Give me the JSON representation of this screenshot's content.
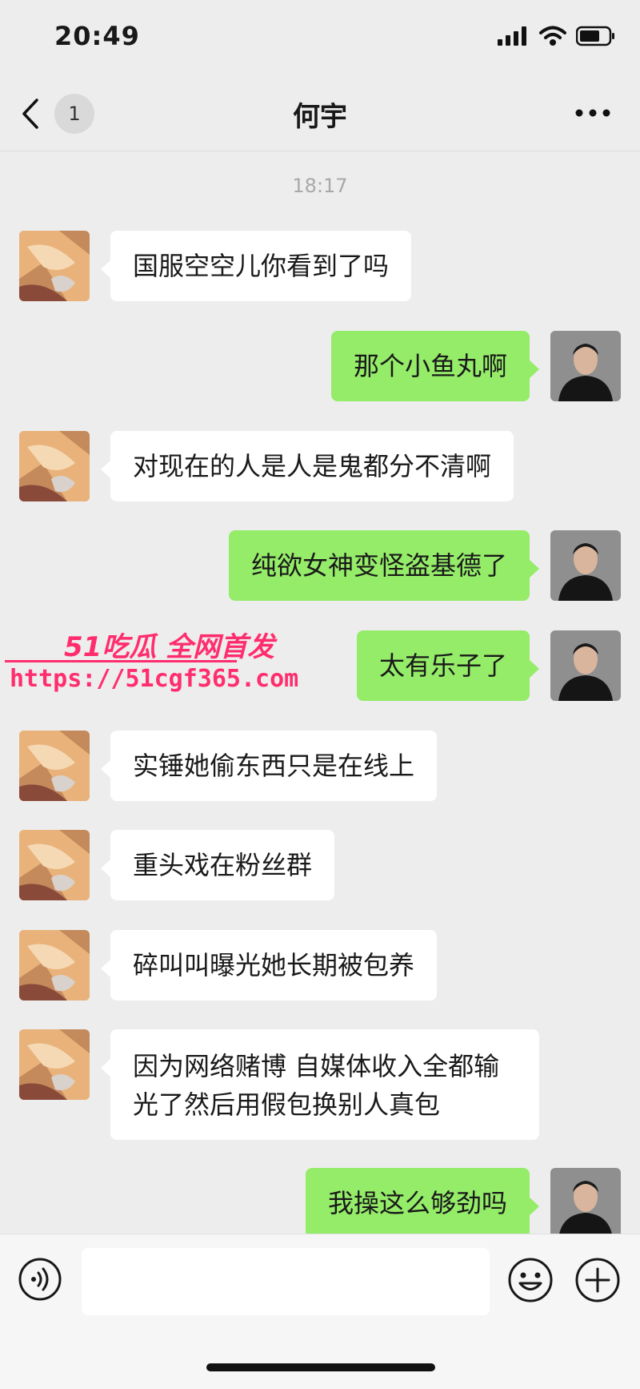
{
  "status_bar": {
    "time": "20:49"
  },
  "nav": {
    "unread_count": "1",
    "title": "何宇"
  },
  "timestamp": "18:17",
  "messages": [
    {
      "side": "left",
      "text": "国服空空儿你看到了吗"
    },
    {
      "side": "right",
      "text": "那个小鱼丸啊"
    },
    {
      "side": "left",
      "text": "对现在的人是人是鬼都分不清啊"
    },
    {
      "side": "right",
      "text": "纯欲女神变怪盗基德了"
    },
    {
      "side": "right",
      "text": "太有乐子了"
    },
    {
      "side": "left",
      "text": "实锤她偷东西只是在线上"
    },
    {
      "side": "left",
      "text": "重头戏在粉丝群"
    },
    {
      "side": "left",
      "text": "碎叫叫曝光她长期被包养"
    },
    {
      "side": "left",
      "text": "因为网络赌博 自媒体收入全都输光了然后用假包换别人真包"
    },
    {
      "side": "right",
      "text": "我操这么够劲吗"
    }
  ],
  "watermark": {
    "brand": "51吃瓜 全网首发",
    "url": "https://51cgf365.com"
  },
  "input": {
    "value": ""
  },
  "colors": {
    "background": "#ededed",
    "incoming_bubble": "#ffffff",
    "outgoing_bubble": "#95ec69",
    "watermark": "#ff2d6e"
  },
  "icons": [
    "back-chevron-icon",
    "more-dots-icon",
    "voice-icon",
    "emoji-icon",
    "plus-icon",
    "signal-icon",
    "wifi-icon",
    "battery-icon"
  ]
}
